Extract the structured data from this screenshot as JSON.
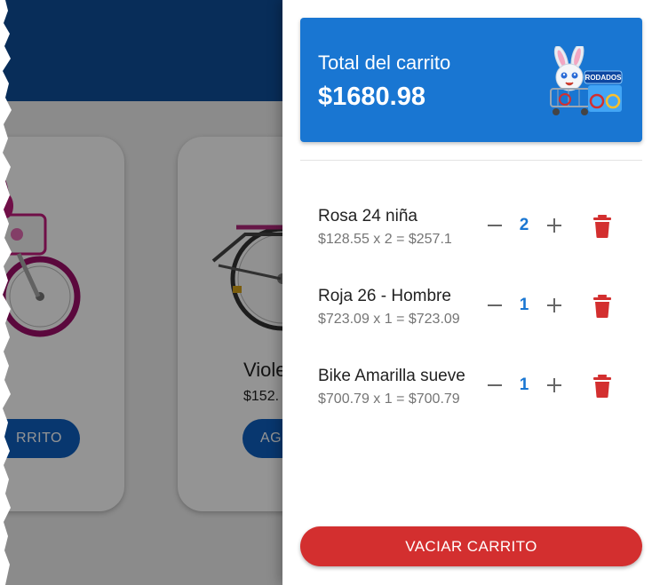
{
  "background": {
    "card_1": {
      "button_label": "RRITO"
    },
    "card_2": {
      "title": "Viole",
      "price": "$152.",
      "button_label": "AG"
    }
  },
  "cart": {
    "total_label": "Total del carrito",
    "total_amount": "$1680.98",
    "logo_text": "RODADOS",
    "items": [
      {
        "name": "Rosa 24 niña",
        "calc": "$128.55 x 2 = $257.1",
        "quantity": "2"
      },
      {
        "name": "Roja 26 - Hombre",
        "calc": "$723.09 x 1 = $723.09",
        "quantity": "1"
      },
      {
        "name": "Bike Amarilla sueve",
        "calc": "$700.79 x 1 = $700.79",
        "quantity": "1"
      }
    ],
    "clear_button_label": "VACIAR CARRITO"
  },
  "icons": {
    "minus": "minus-icon",
    "plus": "plus-icon",
    "trash": "trash-icon"
  },
  "colors": {
    "primary": "#1976d2",
    "danger": "#d32f2f",
    "header": "#0e4f9a"
  }
}
